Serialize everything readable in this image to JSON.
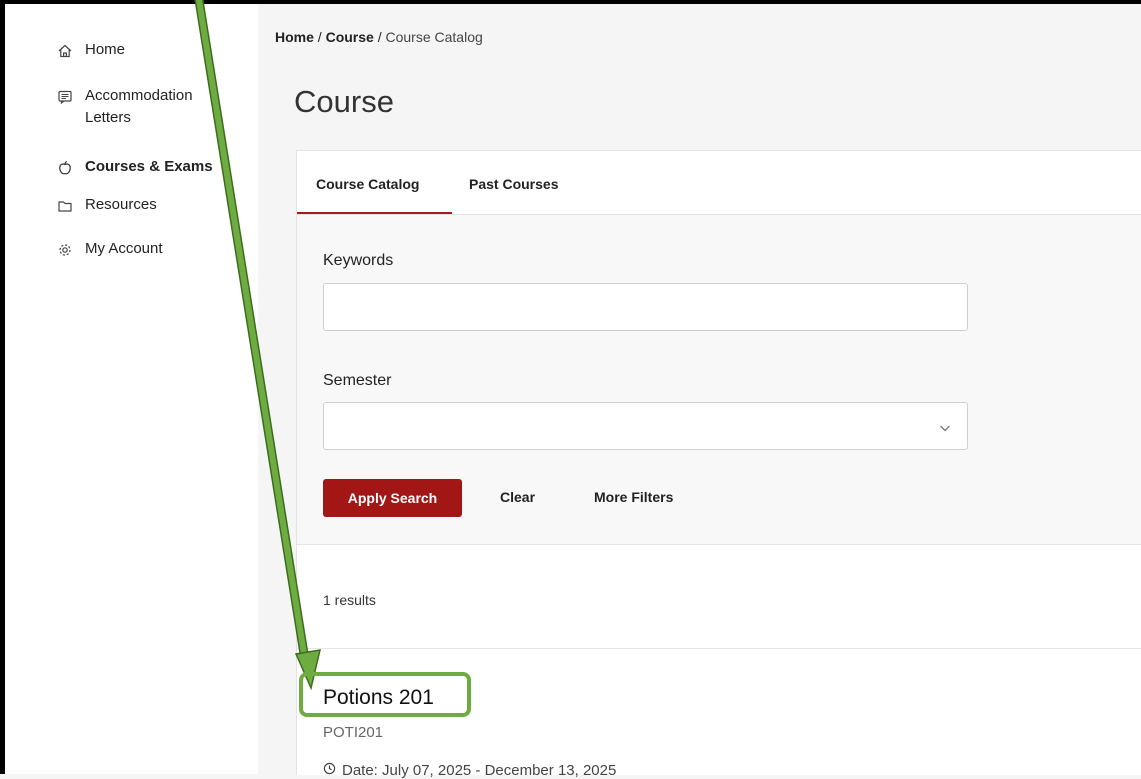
{
  "sidebar": {
    "items": [
      {
        "label": "Home",
        "icon": "home-icon"
      },
      {
        "label": "Accommodation Letters",
        "line1": "Accommodation",
        "line2": "Letters",
        "icon": "letters-icon"
      },
      {
        "label": "Courses & Exams",
        "icon": "apple-icon",
        "active": true
      },
      {
        "label": "Resources",
        "icon": "folder-icon"
      },
      {
        "label": "My Account",
        "icon": "gear-icon"
      }
    ]
  },
  "breadcrumb": {
    "home": "Home",
    "sep": " / ",
    "course": "Course",
    "current": "Course Catalog"
  },
  "page": {
    "title": "Course"
  },
  "tabs": [
    {
      "label": "Course Catalog",
      "active": true
    },
    {
      "label": "Past Courses",
      "active": false
    }
  ],
  "filters": {
    "keywords_label": "Keywords",
    "keywords_value": "",
    "semester_label": "Semester",
    "semester_value": "",
    "apply_label": "Apply Search",
    "clear_label": "Clear",
    "more_filters_label": "More Filters"
  },
  "results": {
    "count_text": "1 results",
    "items": [
      {
        "title": "Potions 201",
        "code": "POTI201",
        "date": "Date: July 07, 2025 - December 13, 2025"
      }
    ]
  },
  "colors": {
    "accent": "#a31616",
    "annotation": "#6eac42"
  }
}
